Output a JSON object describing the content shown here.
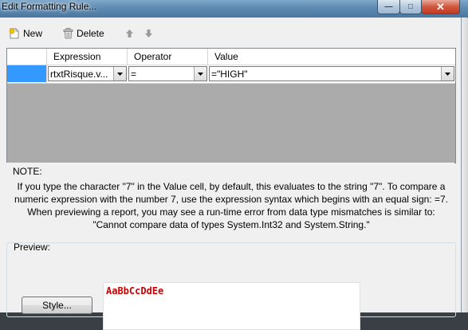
{
  "window": {
    "title": "Edit Formatting Rule..."
  },
  "toolbar": {
    "new_label": "New",
    "delete_label": "Delete"
  },
  "grid": {
    "headers": [
      "Expression",
      "Operator",
      "Value"
    ],
    "row": {
      "expression": "rtxtRisque.v...",
      "operator": "=",
      "value": "=\"HIGH\""
    }
  },
  "note": {
    "title": "NOTE:",
    "lines": [
      "If you type the character \"7\" in the Value cell, by default, this evaluates to the string \"7\". To compare a",
      "numeric expression with the number 7, use the expression syntax which begins with an equal sign: =7.",
      "When previewing a report, you may see a run-time error from data type mismatches is similar to:",
      "\"Cannot compare data of types System.Int32 and System.String.\""
    ]
  },
  "preview": {
    "label": "Preview:",
    "style_button": "Style...",
    "sample_text": "AaBbCcDdEe"
  },
  "colors": {
    "selection": "#3399ff",
    "sample_text": "#cc0000",
    "grid_background": "#ababab"
  }
}
